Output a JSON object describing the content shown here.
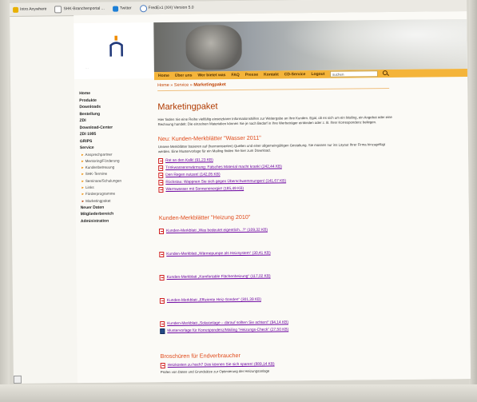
{
  "bookmarks": [
    "Intro Anywhere",
    "SHK-Branchenportal ...",
    "Twitter",
    "FredEx1 (XH) Version 5.0"
  ],
  "logo_text": "...",
  "topnav": [
    "Home",
    "Über uns",
    "Wer bietet was",
    "FAQ",
    "Presse",
    "Kontakt",
    "CD-Service",
    "Logout"
  ],
  "search": {
    "value": "suchen"
  },
  "sidebar": {
    "items_top": [
      "Home",
      "Produkte",
      "Downloads",
      "Bestellung",
      "ZDI",
      "Download-Center",
      "ZDI 1995",
      "GRIPS",
      "Service"
    ],
    "sub_items": [
      "Ansprechpartner",
      "Mentoring/Förderung",
      "Kundenbetreuung",
      "SHK-Termine",
      "Seminare/Schulungen",
      "Links",
      "Förderprogramme",
      "Marketingpaket"
    ],
    "items_bottom": [
      "Neuer Daten",
      "Mitgliederbereich",
      "Administration"
    ]
  },
  "breadcrumb": {
    "home": "Home",
    "service": "Service",
    "current": "Marketingpaket"
  },
  "title": "Marketingpaket",
  "intro": "Hier finden Sie eine Reihe vielfältig einsetzbarer Informationshilfen zur Weitergabe an Ihre Kunden. Egal, ob es sich um ein Mailing, ein Angebot oder eine Rechnung handelt: Die einzelnen Materialien können Sie je nach Bedarf in Ihre Werbeträger einbinden oder z. B. Ihrer Korrespondenz beilegen.",
  "section1": {
    "title": "Neu: Kunden-Merkblätter \"Wasser 2011\"",
    "desc": "Unsere Merkblätter basieren auf (harmonisierten) Quellen und einer allgemeingültigen Gestaltung. Sie müssen nur ins Layout Ihrer Firma hinzugefügt werden. Eine Mustervorlage für ein Mailing finden Sie hier zum Download.",
    "links": [
      "Rat an den Kalk! (91,23 KB)",
      "Trinkwassererwärmung: Falsches Material macht krank! (242,44 KB)",
      "Den Regen nutzen! (142,05 KB)",
      "Rückstau: Wappnen Sie sich gegen Überschwemmungen! (141,67 KB)",
      "Warmwasser mit Sonnenenergie! (185,49 KB)"
    ]
  },
  "section2": {
    "title": "Kunden-Merkblätter \"Heizung 2010\"",
    "links": [
      "Kunden-Merkblatt „Was bedeutet eigentlich...?“ (109,32 KB)",
      "Kunden-Merkblatt „Wärmepumpe als Heizsystem“ (30,41 KB)",
      "Kunden-Merkblatt „Komfortable Flächenheizung“ (117,02 KB)",
      "Kunden-Merkblatt „Effiziente Heiz-Sonden“ (301,39 KB)",
      "Kunden-Merkblatt „Solaranlage – darauf sollten Sie achten!“ (94,14 KB)",
      "Mustervorlage für Korrespondenz/Mailing \"Heizungs-Check\" (27,50 KB)"
    ]
  },
  "section3": {
    "title": "Broschüren für Endverbraucher",
    "links": [
      "Heizkosten zu hoch? Das können Sie sich sparen! (889,14 KB)"
    ],
    "tip": "Prüfen von Daten und Grundsätze zur Optimierung der Heizungsanlage"
  },
  "colors": {
    "accent": "#e04a1a",
    "nav": "#f4b43a",
    "link": "#6a00a0"
  }
}
